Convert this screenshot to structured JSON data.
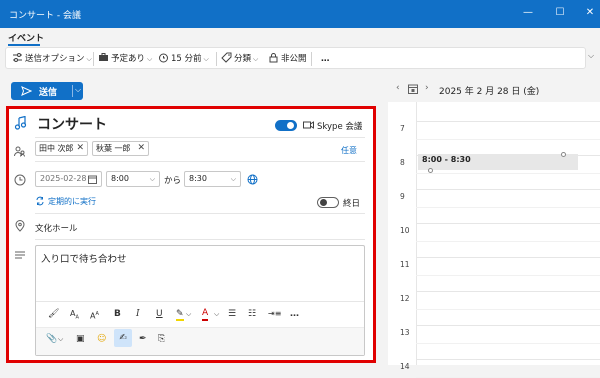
{
  "window": {
    "title": "コンサート - 会議",
    "minimize": "—",
    "maximize": "☐",
    "close": "✕"
  },
  "ribbon": {
    "active_tab": "イベント"
  },
  "toolbar": {
    "send_options": "送信オプション",
    "busy": "予定あり",
    "reminder": "15 分前",
    "category": "分類",
    "private": "非公開",
    "more": "…"
  },
  "send_button": {
    "label": "送信"
  },
  "event": {
    "title": "コンサート",
    "skype": "Skype 会議",
    "skype_enabled": true,
    "attendees": [
      "田中 次郎",
      "秋葉 一郎"
    ],
    "optional_link": "任意",
    "date": "2025-02-28",
    "start_time": "8:00",
    "to_label": "から",
    "end_time": "8:30",
    "recurrence": "定期的に実行",
    "all_day": "終日",
    "all_day_enabled": false,
    "location": "文化ホール",
    "body": "入り口で待ち合わせ"
  },
  "calendar": {
    "date_label": "2025 年 2 月 28 日 (金)",
    "hours": [
      "7",
      "8",
      "9",
      "10",
      "11",
      "12",
      "13",
      "14"
    ],
    "appointment": "8:00 - 8:30"
  },
  "colors": {
    "accent": "#1170c7",
    "highlight_border": "#e00000"
  }
}
